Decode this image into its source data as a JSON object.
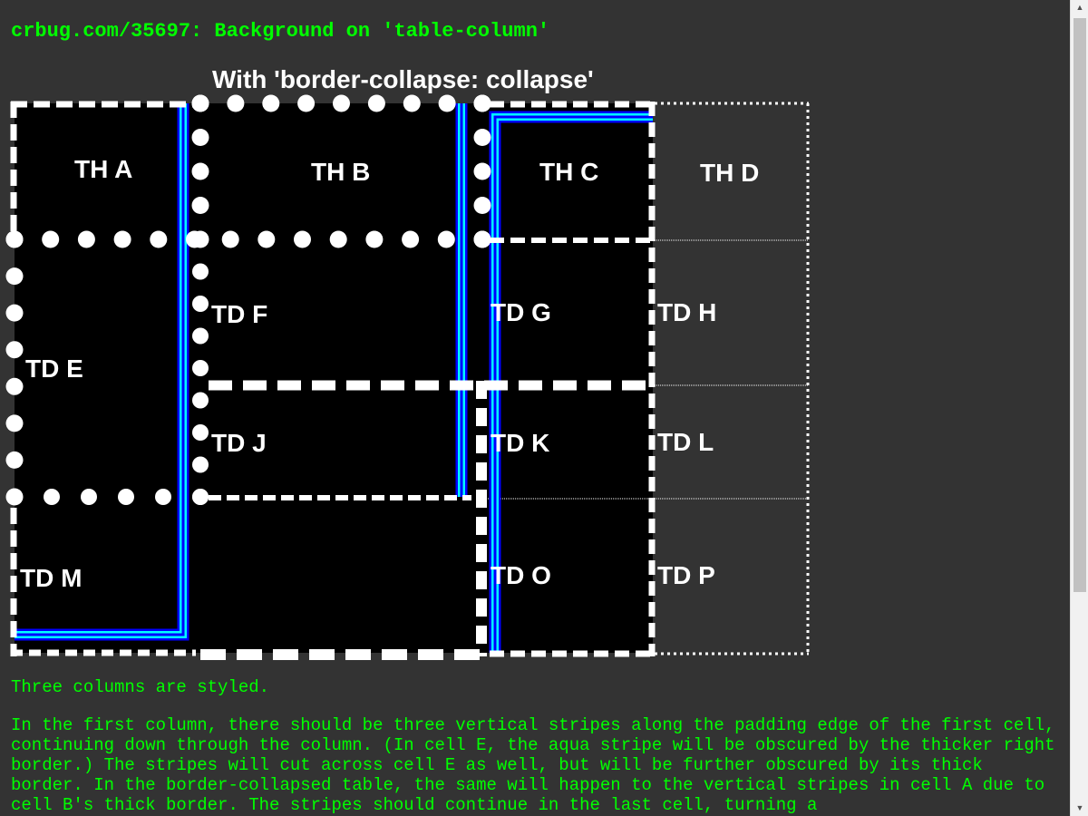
{
  "heading": "crbug.com/35697: Background on 'table-column'",
  "caption": "With 'border-collapse: collapse'",
  "cells": [
    {
      "id": "th-a",
      "label": "TH A"
    },
    {
      "id": "th-b",
      "label": "TH B"
    },
    {
      "id": "th-c",
      "label": "TH C"
    },
    {
      "id": "th-d",
      "label": "TH D"
    },
    {
      "id": "td-e",
      "label": "TD E"
    },
    {
      "id": "td-f",
      "label": "TD F"
    },
    {
      "id": "td-g",
      "label": "TD G"
    },
    {
      "id": "td-h",
      "label": "TD H"
    },
    {
      "id": "td-j",
      "label": "TD J"
    },
    {
      "id": "td-k",
      "label": "TD K"
    },
    {
      "id": "td-l",
      "label": "TD L"
    },
    {
      "id": "td-m",
      "label": "TD M"
    },
    {
      "id": "td-o",
      "label": "TD O"
    },
    {
      "id": "td-p",
      "label": "TD P"
    }
  ],
  "description": {
    "p1": "Three columns are styled.",
    "p2": "In the first column, there should be three vertical stripes along the padding edge of the first cell, continuing down through the column. (In cell E, the aqua stripe will be obscured by the thicker right border.) The stripes will cut across cell E as well, but will be further obscured by its thick border. In the border-collapsed table, the same will happen to the vertical stripes in cell A due to cell B's thick border. The stripes should continue in the last cell, turning a"
  },
  "colors": {
    "page_background": "#333333",
    "text_green": "#00ff00",
    "cell_black": "#000000",
    "border_white": "#ffffff",
    "stripe_blue": "#0000ff",
    "stripe_aqua": "#00ffff"
  },
  "scrollbar": {
    "up_icon": "triangle-up-icon",
    "down_icon": "triangle-down-icon"
  }
}
